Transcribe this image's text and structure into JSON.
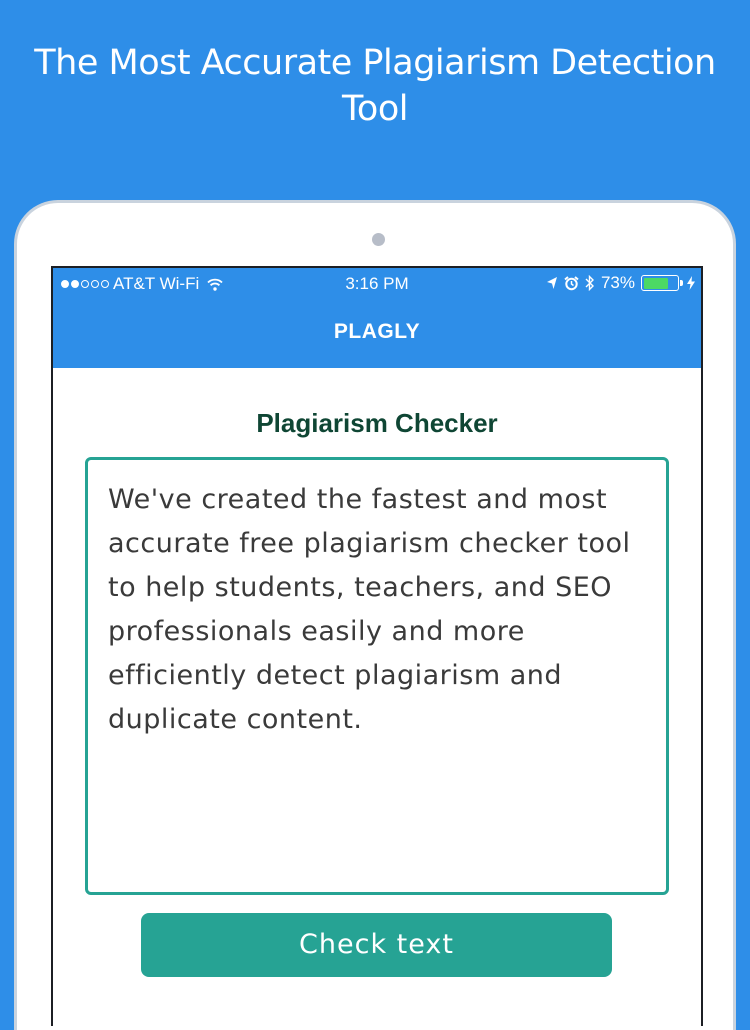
{
  "headline": "The Most Accurate Plagiarism Detection Tool",
  "status_bar": {
    "carrier": "AT&T Wi-Fi",
    "time": "3:16 PM",
    "battery_percent": "73%",
    "signal_bars_filled": 2,
    "signal_bars_total": 5,
    "battery_level": 0.73,
    "icons": [
      "signal-dots-icon",
      "wifi-icon",
      "location-arrow-icon",
      "alarm-icon",
      "bluetooth-icon",
      "battery-icon",
      "charging-bolt-icon"
    ]
  },
  "nav": {
    "title": "PLAGLY"
  },
  "checker": {
    "title": "Plagiarism Checker",
    "text": "We've created the fastest and most accurate free plagiarism checker tool to help students, teachers, and SEO professionals easily and more efficiently detect plagiarism and duplicate content.",
    "button_label": "Check text"
  },
  "colors": {
    "background": "#2e8ee8",
    "accent": "#26a394",
    "title_text": "#0f4634",
    "battery": "#4cd964"
  }
}
